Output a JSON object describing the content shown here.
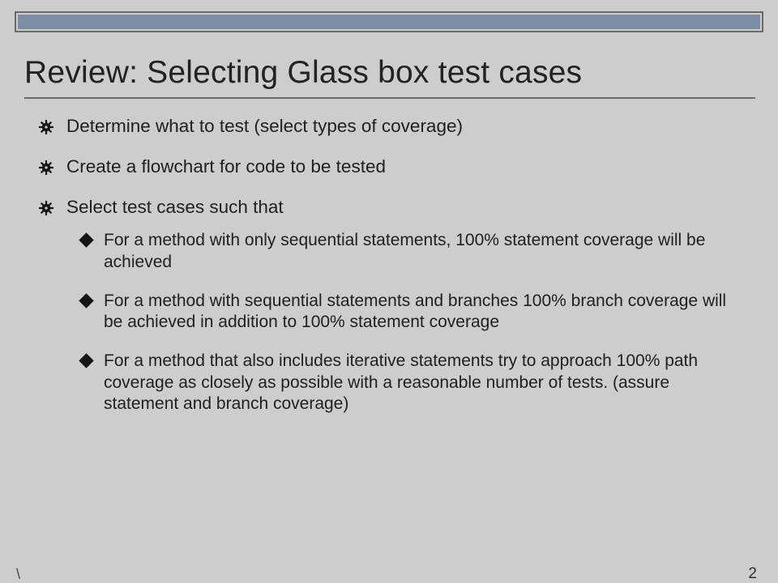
{
  "slide": {
    "title": "Review: Selecting Glass box test cases",
    "bullets": [
      {
        "text": "Determine what to test (select types of coverage)"
      },
      {
        "text": "Create a flowchart for code to be tested"
      },
      {
        "text": "Select test cases such that",
        "sub": [
          "For a method with only sequential statements, 100% statement coverage will be achieved",
          "For a method with sequential statements and branches 100% branch coverage will be achieved in addition to 100% statement coverage",
          "For a method that also includes iterative statements try to approach 100% path coverage as closely as possible with a reasonable number of tests. (assure statement and branch coverage)"
        ]
      }
    ]
  },
  "footer": {
    "left": "\\",
    "right": "2"
  }
}
